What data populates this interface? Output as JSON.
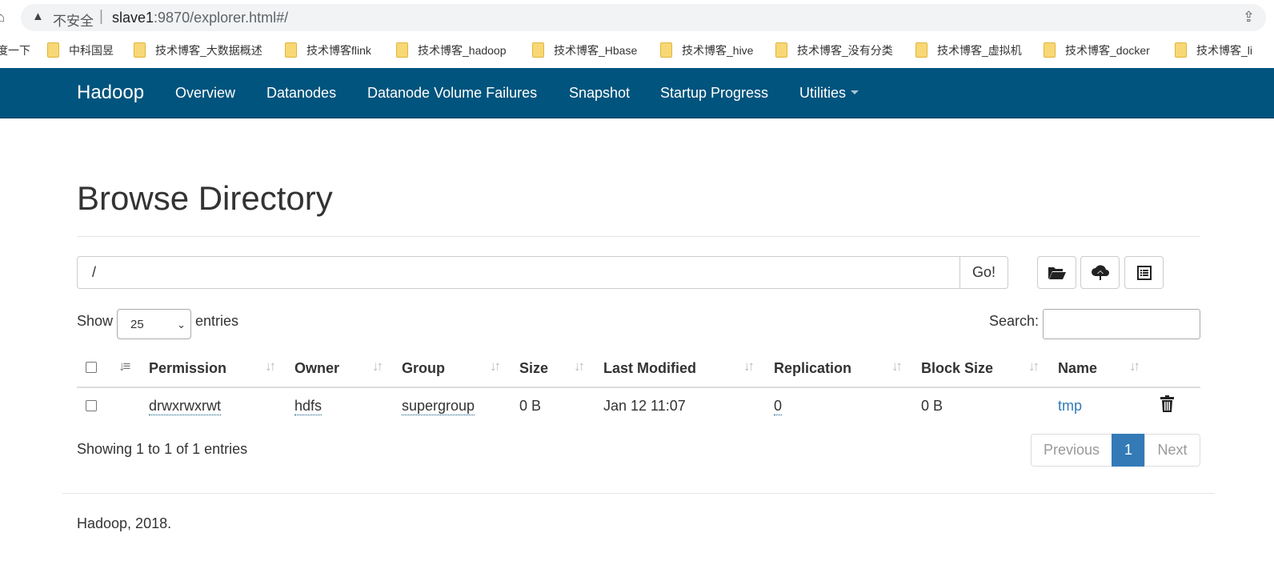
{
  "browser": {
    "insecure_label": "不安全",
    "separator": "|",
    "url_host": "slave1",
    "url_rest": ":9870/explorer.html#/",
    "bookmarks": [
      {
        "label": "度一下"
      },
      {
        "label": "中科国昱"
      },
      {
        "label": "技术博客_大数据概述"
      },
      {
        "label": "技术博客flink"
      },
      {
        "label": "技术博客_hadoop"
      },
      {
        "label": "技术博客_Hbase"
      },
      {
        "label": "技术博客_hive"
      },
      {
        "label": "技术博客_没有分类"
      },
      {
        "label": "技术博客_虚拟机"
      },
      {
        "label": "技术博客_docker"
      },
      {
        "label": "技术博客_li"
      }
    ]
  },
  "navbar": {
    "brand": "Hadoop",
    "items": [
      {
        "label": "Overview"
      },
      {
        "label": "Datanodes"
      },
      {
        "label": "Datanode Volume Failures"
      },
      {
        "label": "Snapshot"
      },
      {
        "label": "Startup Progress"
      },
      {
        "label": "Utilities"
      }
    ]
  },
  "page": {
    "title": "Browse Directory",
    "path_value": "/",
    "go_label": "Go!",
    "show_label": "Show",
    "entries_value": "25",
    "entries_label": "entries",
    "search_label": "Search:",
    "search_value": ""
  },
  "table": {
    "columns": [
      "Permission",
      "Owner",
      "Group",
      "Size",
      "Last Modified",
      "Replication",
      "Block Size",
      "Name"
    ],
    "rows": [
      {
        "permission": "drwxrwxrwt",
        "owner": "hdfs",
        "group": "supergroup",
        "size": "0 B",
        "last_modified": "Jan 12 11:07",
        "replication": "0",
        "block_size": "0 B",
        "name": "tmp"
      }
    ]
  },
  "pagination": {
    "showing": "Showing 1 to 1 of 1 entries",
    "previous": "Previous",
    "current": "1",
    "next": "Next"
  },
  "footer": {
    "text": "Hadoop, 2018."
  },
  "colors": {
    "navbar": "#00547d",
    "link": "#337ab7",
    "active_page": "#337ab7"
  },
  "icons": {
    "toolbar": [
      "folder-open-icon",
      "cloud-upload-icon",
      "list-icon"
    ],
    "row_action": "trash-icon"
  }
}
